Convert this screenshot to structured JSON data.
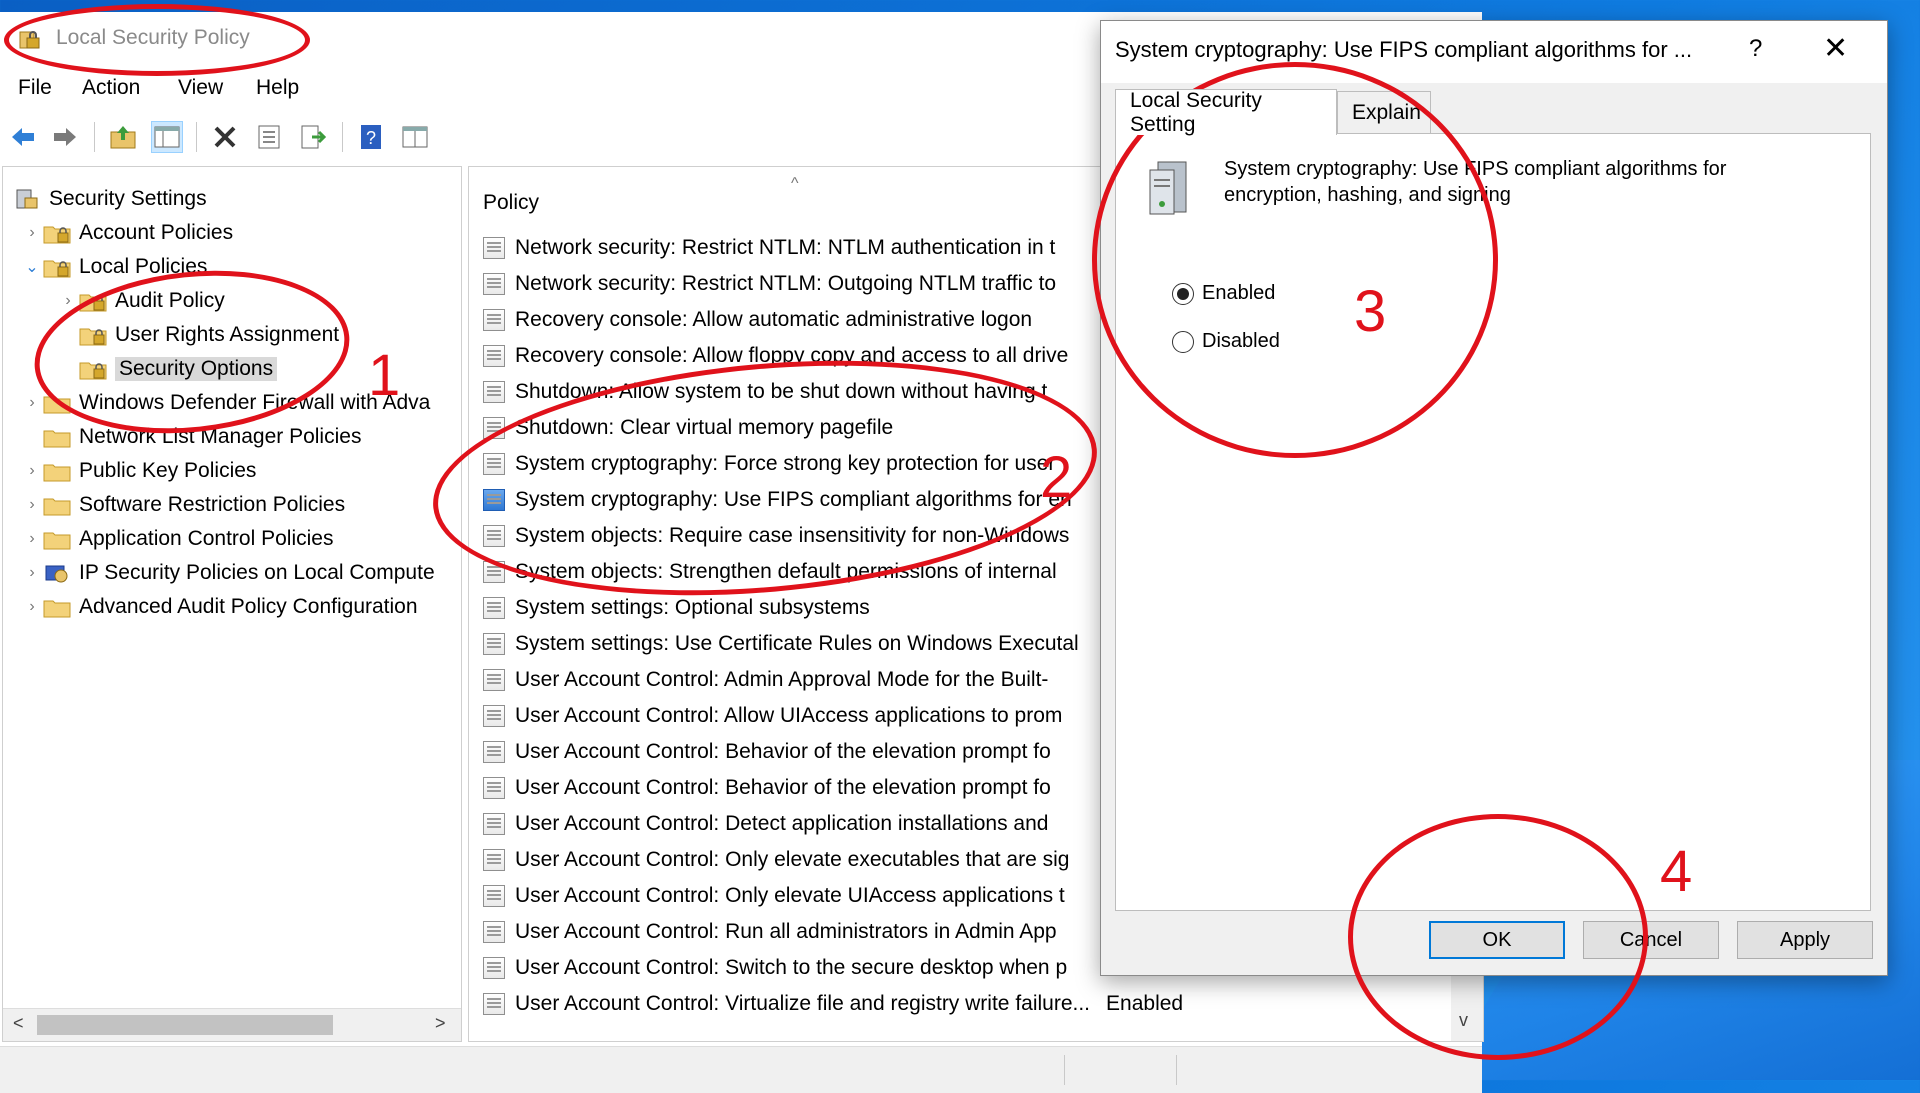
{
  "window": {
    "title": "Local Security Policy",
    "menu": [
      "File",
      "Action",
      "View",
      "Help"
    ]
  },
  "toolbar": {
    "icons": [
      "back-arrow-icon",
      "forward-arrow-icon",
      "up-folder-icon",
      "show-hide-tree-icon",
      "delete-icon",
      "properties-icon",
      "export-list-icon",
      "help-icon",
      "console-view-icon"
    ]
  },
  "tree": {
    "items": [
      {
        "label": "Security Settings",
        "level": 0,
        "expander": "",
        "icon": "security-settings-icon"
      },
      {
        "label": "Account Policies",
        "level": 1,
        "expander": ">",
        "icon": "folder-lock-icon"
      },
      {
        "label": "Local Policies",
        "level": 1,
        "expander": "v",
        "icon": "folder-lock-icon"
      },
      {
        "label": "Audit Policy",
        "level": 2,
        "expander": ">",
        "icon": "folder-lock-icon"
      },
      {
        "label": "User Rights Assignment",
        "level": 2,
        "expander": "",
        "icon": "folder-lock-icon"
      },
      {
        "label": "Security Options",
        "level": 2,
        "expander": "",
        "icon": "folder-lock-icon",
        "selected": true
      },
      {
        "label": "Windows Defender Firewall with Adva",
        "level": 1,
        "expander": ">",
        "icon": "folder-icon"
      },
      {
        "label": "Network List Manager Policies",
        "level": 1,
        "expander": "",
        "icon": "folder-icon"
      },
      {
        "label": "Public Key Policies",
        "level": 1,
        "expander": ">",
        "icon": "folder-icon"
      },
      {
        "label": "Software Restriction Policies",
        "level": 1,
        "expander": ">",
        "icon": "folder-icon"
      },
      {
        "label": "Application Control Policies",
        "level": 1,
        "expander": ">",
        "icon": "folder-icon"
      },
      {
        "label": "IP Security Policies on Local Compute",
        "level": 1,
        "expander": ">",
        "icon": "ip-security-icon"
      },
      {
        "label": "Advanced Audit Policy Configuration",
        "level": 1,
        "expander": ">",
        "icon": "folder-icon"
      }
    ]
  },
  "list": {
    "column_header": "Policy",
    "rows": [
      {
        "policy": "Network security: Restrict NTLM: NTLM authentication in t",
        "setting": ""
      },
      {
        "policy": "Network security: Restrict NTLM: Outgoing NTLM traffic to",
        "setting": ""
      },
      {
        "policy": "Recovery console: Allow automatic administrative logon",
        "setting": ""
      },
      {
        "policy": "Recovery console: Allow floppy copy and access to all drive",
        "setting": ""
      },
      {
        "policy": "Shutdown: Allow system to be shut down without having t",
        "setting": ""
      },
      {
        "policy": "Shutdown: Clear virtual memory pagefile",
        "setting": ""
      },
      {
        "policy": "System cryptography: Force strong key protection for user",
        "setting": ""
      },
      {
        "policy": "System cryptography: Use FIPS compliant algorithms for en",
        "setting": "",
        "selected": true
      },
      {
        "policy": "System objects: Require case insensitivity for non-Windows",
        "setting": ""
      },
      {
        "policy": "System objects: Strengthen default permissions of internal",
        "setting": ""
      },
      {
        "policy": "System settings: Optional subsystems",
        "setting": ""
      },
      {
        "policy": "System settings: Use Certificate Rules on Windows Executal",
        "setting": ""
      },
      {
        "policy": "User Account Control: Admin Approval Mode for the Built-",
        "setting": ""
      },
      {
        "policy": "User Account Control: Allow UIAccess applications to prom",
        "setting": ""
      },
      {
        "policy": "User Account Control: Behavior of the elevation prompt fo",
        "setting": ""
      },
      {
        "policy": "User Account Control: Behavior of the elevation prompt fo",
        "setting": ""
      },
      {
        "policy": "User Account Control: Detect application installations and",
        "setting": ""
      },
      {
        "policy": "User Account Control: Only elevate executables that are sig",
        "setting": ""
      },
      {
        "policy": "User Account Control: Only elevate UIAccess applications t",
        "setting": ""
      },
      {
        "policy": "User Account Control: Run all administrators in Admin App",
        "setting": ""
      },
      {
        "policy": "User Account Control: Switch to the secure desktop when p",
        "setting": ""
      },
      {
        "policy": "User Account Control: Virtualize file and registry write failure...",
        "setting": "Enabled"
      }
    ]
  },
  "dialog": {
    "title": "System cryptography: Use FIPS compliant algorithms for ...",
    "help_glyph": "?",
    "close_glyph": "✕",
    "tabs": [
      "Local Security Setting",
      "Explain"
    ],
    "description": "System cryptography: Use FIPS compliant algorithms for encryption, hashing, and signing",
    "options": [
      {
        "label": "Enabled",
        "checked": true
      },
      {
        "label": "Disabled",
        "checked": false
      }
    ],
    "buttons": {
      "ok": "OK",
      "cancel": "Cancel",
      "apply": "Apply"
    }
  },
  "annotations": {
    "color": "#e0121b",
    "labels": [
      "1",
      "2",
      "3",
      "4"
    ]
  }
}
